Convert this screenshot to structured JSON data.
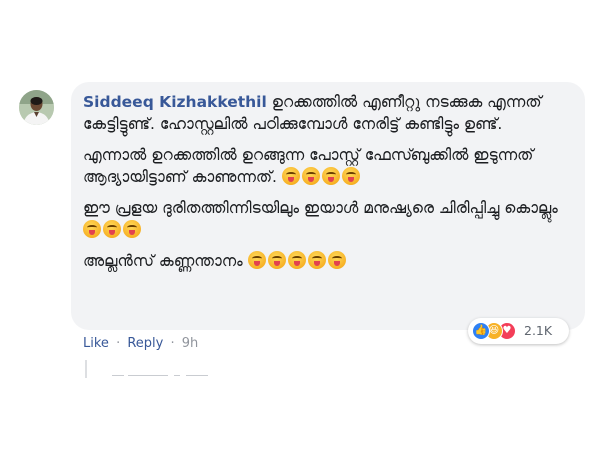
{
  "comment": {
    "author": "Siddeeq Kizhakkethil",
    "paragraphs": [
      "ഉറക്കത്തിൽ എണീറ്റു നടക്കുക എന്നത് കേട്ടിട്ടുണ്ട്. ഹോസ്റ്റലിൽ പഠിക്കുമ്പോൾ നേരിട്ട് കണ്ടിട്ടും ഉണ്ട്.",
      "എന്നാൽ ഉറക്കത്തിൽ ഉറങ്ങുന്ന പോസ്റ്റ് ഫേസ്ബുക്കിൽ ഇടുന്നത് ആദ്യായിട്ടാണ് കാണുന്നത്.",
      "ഈ പ്രളയ ദുരിതത്തിന്നിടയിലും ഇയാൾ മനുഷ്യരെ ചിരിപ്പിച്ചു കൊല്ലും",
      "അല്ലൻസ് കണ്ണന്താനം"
    ],
    "emoji_counts": [
      0,
      4,
      3,
      5
    ]
  },
  "reactions": {
    "icons": [
      "like-icon",
      "haha-icon",
      "love-icon"
    ],
    "count": "2.1K"
  },
  "actions": {
    "like": "Like",
    "reply": "Reply",
    "separator": "·",
    "time": "9h"
  },
  "colors": {
    "bubble": "#f2f3f5",
    "author": "#385898",
    "link": "#385898"
  }
}
